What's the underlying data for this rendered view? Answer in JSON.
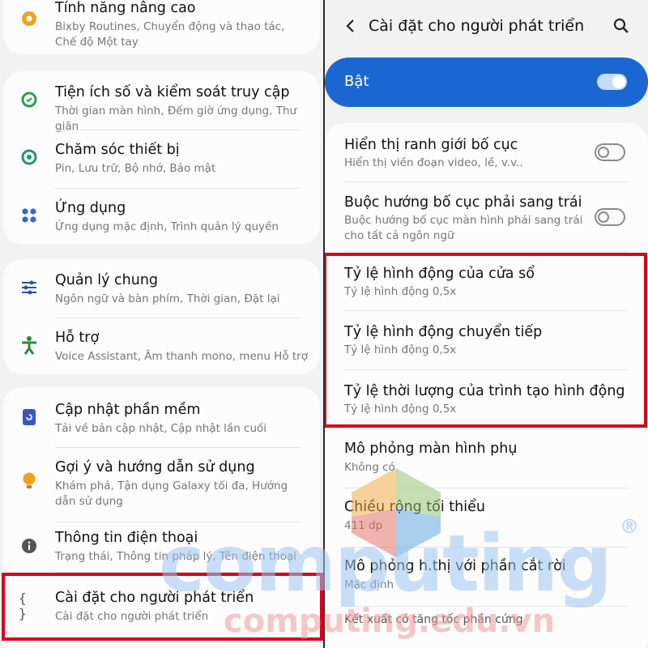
{
  "left": {
    "items": [
      {
        "title": "Tính năng nâng cao",
        "sub": "Bixby Routines, Chuyển động và thao tác, Chế độ Một tay"
      },
      {
        "title": "Tiện ích số và kiểm soát truy cập",
        "sub": "Thời gian màn hình, Đếm giờ ứng dụng, Thư giãn"
      },
      {
        "title": "Chăm sóc thiết bị",
        "sub": "Pin, Lưu trữ, Bộ nhớ, Bảo mật"
      },
      {
        "title": "Ứng dụng",
        "sub": "Ứng dụng mặc định, Trình quản lý quyền"
      },
      {
        "title": "Quản lý chung",
        "sub": "Ngôn ngữ và bàn phím, Thời gian, Đặt lại"
      },
      {
        "title": "Hỗ trợ",
        "sub": "Voice Assistant, Âm thanh mono, menu Hỗ trợ"
      },
      {
        "title": "Cập nhật phần mềm",
        "sub": "Tải về bản cập nhật, Cập nhật lần cuối"
      },
      {
        "title": "Gợi ý và hướng dẫn sử dụng",
        "sub": "Khám phá, Tận dụng Galaxy tối đa, Hướng dẫn sử dụng"
      },
      {
        "title": "Thông tin điện thoại",
        "sub": "Trạng thái, Thông tin pháp lý, Tên điện thoại"
      },
      {
        "title": "Cài đặt cho người phát triển",
        "sub": "Cài đặt cho người phát triển"
      }
    ]
  },
  "right": {
    "header_title": "Cài đặt cho người phát triển",
    "master_label": "Bật",
    "master_on": true,
    "items": [
      {
        "title": "Hiển thị ranh giới bố cục",
        "sub": "Hiển thị viền đoạn video, lề, v.v.."
      },
      {
        "title": "Buộc hướng bố cục phải sang trái",
        "sub": "Buộc hướng bố cục màn hình phải sang trái cho tất cả ngôn ngữ"
      },
      {
        "title": "Tỷ lệ hình động của cửa sổ",
        "sub": "Tỷ lệ hình động 0,5x"
      },
      {
        "title": "Tỷ lệ hình động chuyển tiếp",
        "sub": "Tỷ lệ hình động 0,5x"
      },
      {
        "title": "Tỷ lệ thời lượng của trình tạo hình động",
        "sub": "Tỷ lệ hình động 0,5x"
      },
      {
        "title": "Mô phỏng màn hình phụ",
        "sub": "Không có"
      },
      {
        "title": "Chiều rộng tối thiểu",
        "sub": "411 dp"
      },
      {
        "title": "Mô phỏng h.thị với phần cắt rời",
        "sub": "Mặc định"
      },
      {
        "title": "Kết xuất có tăng tốc phần cứng",
        "sub": ""
      }
    ]
  },
  "watermark": {
    "big": "computing",
    "small": "computing.edu.vn",
    "mark": "®"
  },
  "colors": {
    "accent": "#1a67d2",
    "highlight": "#d9001b"
  },
  "icons": [
    "star-gear-icon",
    "digital-wellbeing-icon",
    "device-care-icon",
    "apps-icon",
    "general-management-icon",
    "accessibility-icon",
    "software-update-icon",
    "tips-icon",
    "about-phone-icon",
    "developer-options-icon",
    "back-arrow-icon",
    "search-icon"
  ]
}
